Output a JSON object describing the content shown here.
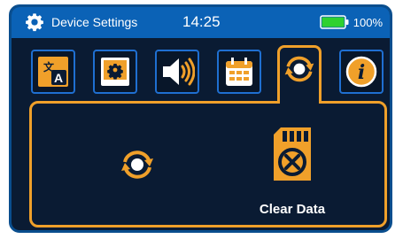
{
  "status_bar": {
    "title": "Device Settings",
    "time": "14:25",
    "battery_percent": "100%",
    "battery_level": 1.0,
    "battery_color": "#2fd12f"
  },
  "tabs": [
    {
      "icon": "language-translate-icon",
      "active": false
    },
    {
      "icon": "display-settings-icon",
      "active": false
    },
    {
      "icon": "speaker-volume-icon",
      "active": false
    },
    {
      "icon": "calendar-icon",
      "active": false
    },
    {
      "icon": "sync-icon",
      "active": true
    },
    {
      "icon": "info-icon",
      "active": false
    }
  ],
  "panel": {
    "icon": "sync-icon",
    "action": {
      "icon": "sd-card-clear-icon",
      "label": "Clear Data"
    }
  },
  "colors": {
    "accent": "#f0a02a",
    "status_bar": "#0b62b6",
    "background": "#0a1b33",
    "tab_border": "#1f6fd1"
  }
}
